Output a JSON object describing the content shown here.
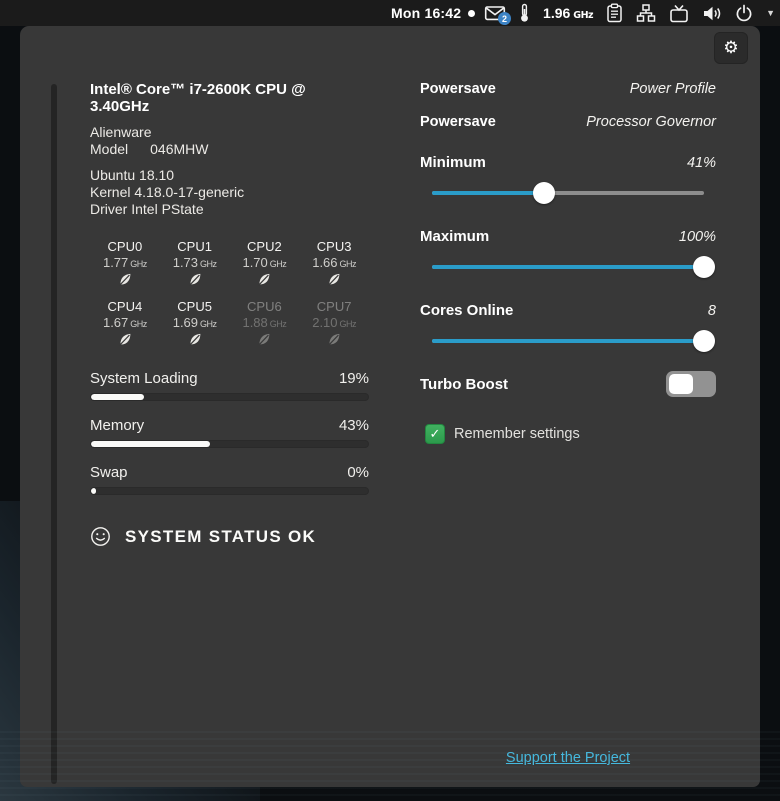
{
  "topbar": {
    "clock": "Mon 16:42",
    "message_badge": "2",
    "frequency_value": "1.96",
    "frequency_unit": "GHz"
  },
  "window": {
    "system_info": {
      "cpu_model": "Intel® Core™ i7-2600K CPU @ 3.40GHz",
      "vendor": "Alienware",
      "model_label": "Model",
      "model_number": "046MHW",
      "os": "Ubuntu 18.10",
      "kernel": "Kernel 4.18.0-17-generic",
      "driver": "Driver Intel PState"
    },
    "cpus": [
      {
        "name": "CPU0",
        "freq": "1.77",
        "unit": "GHz",
        "online": true
      },
      {
        "name": "CPU1",
        "freq": "1.73",
        "unit": "GHz",
        "online": true
      },
      {
        "name": "CPU2",
        "freq": "1.70",
        "unit": "GHz",
        "online": true
      },
      {
        "name": "CPU3",
        "freq": "1.66",
        "unit": "GHz",
        "online": true
      },
      {
        "name": "CPU4",
        "freq": "1.67",
        "unit": "GHz",
        "online": true
      },
      {
        "name": "CPU5",
        "freq": "1.69",
        "unit": "GHz",
        "online": true
      },
      {
        "name": "CPU6",
        "freq": "1.88",
        "unit": "GHz",
        "online": false
      },
      {
        "name": "CPU7",
        "freq": "2.10",
        "unit": "GHz",
        "online": false
      }
    ],
    "meters": [
      {
        "label": "System Loading",
        "value": "19%",
        "percent": 19
      },
      {
        "label": "Memory",
        "value": "43%",
        "percent": 43
      },
      {
        "label": "Swap",
        "value": "0%",
        "percent": 0
      }
    ],
    "status_message": "SYSTEM STATUS OK",
    "settings_rows": [
      {
        "value": "Powersave",
        "label": "Power Profile"
      },
      {
        "value": "Powersave",
        "label": "Processor Governor"
      }
    ],
    "sliders": [
      {
        "label": "Minimum",
        "value": "41%",
        "percent": 41
      },
      {
        "label": "Maximum",
        "value": "100%",
        "percent": 100
      },
      {
        "label": "Cores Online",
        "value": "8",
        "percent": 100
      }
    ],
    "turbo": {
      "label": "Turbo Boost",
      "enabled": "false"
    },
    "remember": {
      "label": "Remember settings",
      "checked": "true",
      "check_glyph": "✓"
    },
    "footer_link": "Support the Project"
  },
  "colors": {
    "accent_blue": "#2a9cc9",
    "link_blue": "#45b8dd",
    "check_green": "#2fa757",
    "badge_blue": "#3d84c6"
  }
}
